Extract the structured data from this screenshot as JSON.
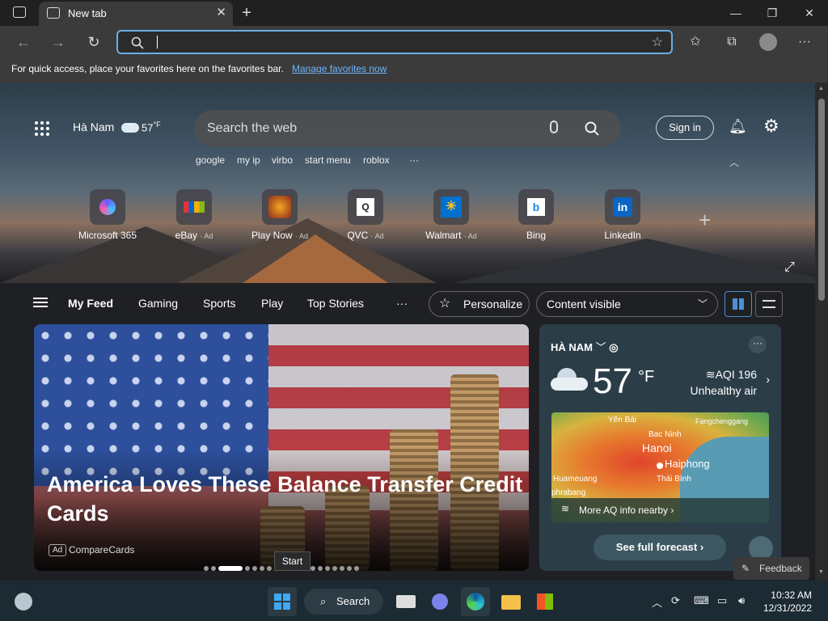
{
  "tab": {
    "title": "New tab"
  },
  "window": {
    "new_tab": "+",
    "minimize": "—",
    "restore": "❐",
    "close": "✕"
  },
  "toolbar": {
    "address_value": ""
  },
  "favbar": {
    "message": "For quick access, place your favorites here on the favorites bar.",
    "link": "Manage favorites now"
  },
  "header": {
    "location": "Hà Nam",
    "temperature": "57",
    "temp_unit": "°F",
    "search_placeholder": "Search the web",
    "sign_in": "Sign in"
  },
  "suggestions": [
    "google",
    "my ip",
    "virbo",
    "start menu",
    "roblox",
    "···"
  ],
  "quicklinks": [
    {
      "name": "Microsoft 365",
      "ad": ""
    },
    {
      "name": "eBay",
      "ad": "· Ad"
    },
    {
      "name": "Play Now",
      "ad": "· Ad"
    },
    {
      "name": "QVC",
      "ad": "· Ad"
    },
    {
      "name": "Walmart",
      "ad": "· Ad"
    },
    {
      "name": "Bing",
      "ad": ""
    },
    {
      "name": "LinkedIn",
      "ad": ""
    }
  ],
  "feed": {
    "tabs": [
      "My Feed",
      "Gaming",
      "Sports",
      "Play",
      "Top Stories"
    ],
    "more": "···",
    "personalize": "Personalize",
    "content_visible": "Content visible"
  },
  "article": {
    "headline": "America Loves These Balance Transfer Credit Cards",
    "ad_tag": "Ad",
    "source": "CompareCards"
  },
  "weather": {
    "location": "HÀ NAM",
    "temperature": "57",
    "unit": "°F",
    "aqi": "AQI 196",
    "aqi_status": "Unhealthy air",
    "map_labels": [
      "Yên Bái",
      "Bac Ninh",
      "Fangchenggang",
      "Hanoi",
      "Haiphong",
      "Huameuang",
      "Thái Bình",
      "phrabang"
    ],
    "more_aq": "More AQ info nearby",
    "forecast": "See full forecast"
  },
  "tooltip": "Start",
  "feedback": "Feedback",
  "taskbar": {
    "search": "Search",
    "time": "10:32 AM",
    "date": "12/31/2022"
  }
}
